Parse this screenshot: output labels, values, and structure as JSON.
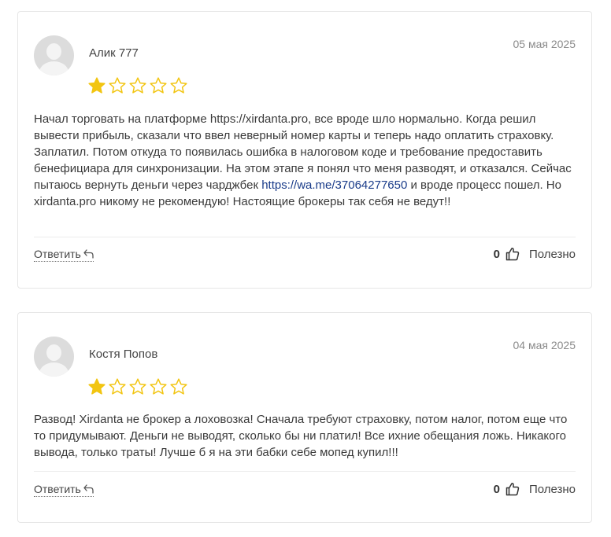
{
  "reviews": [
    {
      "author": "Алик 777",
      "date": "05 мая 2025",
      "rating": 1,
      "max_rating": 5,
      "text_before_link": "Начал торговать на платформе https://xirdanta.pro, все вроде шло нормально. Когда решил вывести прибыль, сказали что ввел неверный номер карты и теперь надо оплатить страховку. Заплатил. Потом откуда то появилась ошибка в налоговом коде и требование предоставить бенефициара для синхронизации. На этом этапе я понял что меня разводят, и отказался. Сейчас пытаюсь вернуть деньги через чарджбек ",
      "link": "https://wa.me/37064277650",
      "text_after_link": " и вроде процесс пошел. Но xirdanta.pro никому не рекомендую! Настоящие брокеры так себя не ведут!!",
      "reply_label": "Ответить",
      "helpful_count": "0",
      "helpful_label": "Полезно"
    },
    {
      "author": "Костя Попов",
      "date": "04 мая 2025",
      "rating": 1,
      "max_rating": 5,
      "text": "Развод! Xirdanta не брокер а лоховозка! Сначала требуют страховку, потом налог, потом еще что то придумывают. Деньги не выводят, сколько бы ни платил! Все ихние обещания ложь. Никакого вывода, только траты! Лучше б я на эти бабки себе мопед купил!!!",
      "reply_label": "Ответить",
      "helpful_count": "0",
      "helpful_label": "Полезно"
    }
  ],
  "colors": {
    "star_filled": "#f2c511",
    "star_empty": "#f2c511",
    "link": "#1a3c8a"
  },
  "icons": {
    "reply": "reply-arrow-icon",
    "helpful": "thumbs-up-icon",
    "avatar": "user-avatar-placeholder"
  }
}
